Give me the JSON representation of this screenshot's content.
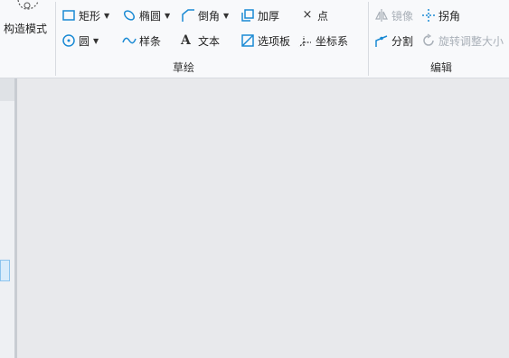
{
  "ribbon": {
    "construct_mode": "构造模式",
    "sketch": {
      "label": "草绘",
      "rectangle": "矩形",
      "ellipse": "椭圆",
      "chamfer": "倒角",
      "thicken": "加厚",
      "point": "点",
      "circle": "圆",
      "spline": "样条",
      "text": "文本",
      "palette": "选项板",
      "coordsys": "坐标系"
    },
    "edit": {
      "label": "编辑",
      "mirror": "镜像",
      "corner": "拐角",
      "divide": "分割",
      "rotate_resize": "旋转调整大小"
    }
  },
  "colors": {
    "icon": "#1a8ad4",
    "disabled": "#a9b0b8",
    "canvas": "#e8e9ec"
  }
}
